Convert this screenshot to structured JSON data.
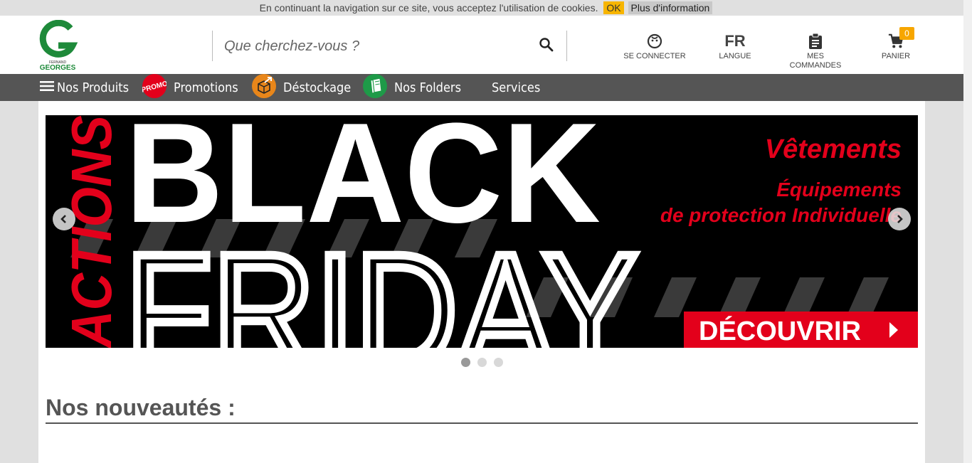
{
  "cookie": {
    "message": "En continuant la navigation sur ce site, vous acceptez l'utilisation de cookies.",
    "ok_label": "OK",
    "more_label": "Plus d'information"
  },
  "logo": {
    "letter": "G",
    "line1": "FERNAND",
    "line2": "GEORGES",
    "color": "#1e8a3a"
  },
  "search": {
    "placeholder": "Que cherchez-vous ?",
    "value": ""
  },
  "header": {
    "login_label": "SE CONNECTER",
    "lang_code": "FR",
    "lang_label": "LANGUE",
    "orders_label_1": "MES",
    "orders_label_2": "COMMANDES",
    "cart_label": "PANIER",
    "cart_count": "0"
  },
  "nav": {
    "products": "Nos Produits",
    "promo_badge": "PROMO",
    "promotions": "Promotions",
    "destock": "Déstockage",
    "folders": "Nos Folders",
    "services": "Services"
  },
  "banner": {
    "side_text": "ACTIONS",
    "line1": "BLACK",
    "line2": "FRIDAY",
    "cat1": "Vêtements",
    "cat2": "Équipements",
    "cat3": "de protection Individuelle",
    "cta": "DÉCOUVRIR",
    "accent": "#e3001b"
  },
  "carousel": {
    "slide_count": 3,
    "active_index": 0
  },
  "section": {
    "title": "Nos nouveautés :"
  }
}
